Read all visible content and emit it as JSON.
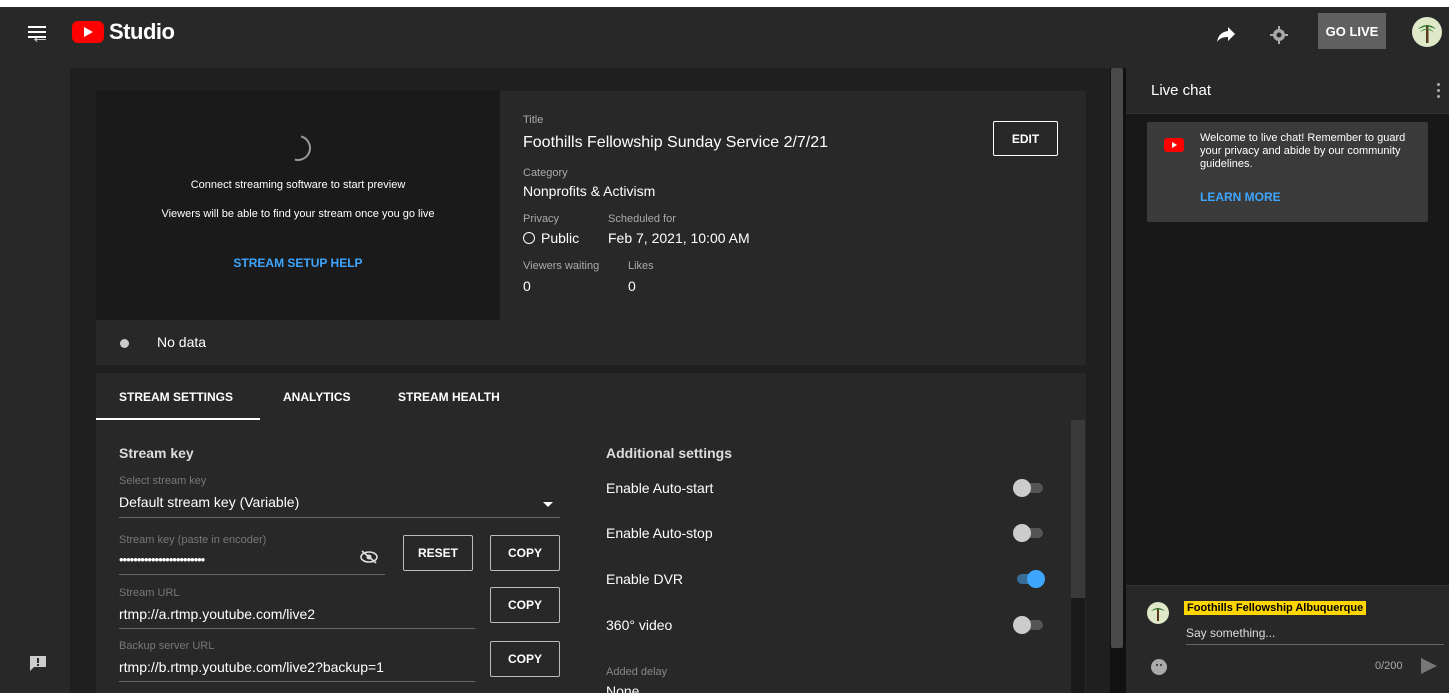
{
  "header": {
    "app_name": "Studio",
    "go_live_label": "GO LIVE",
    "icons": [
      "menu-icon",
      "share-arrow-icon",
      "gear-icon",
      "avatar"
    ]
  },
  "preview": {
    "message_line1": "Connect streaming software to start preview",
    "message_line2": "Viewers will be able to find your stream once you go live",
    "setup_help_link": "STREAM SETUP HELP"
  },
  "details": {
    "title_label": "Title",
    "title_value": "Foothills Fellowship Sunday Service 2/7/21",
    "edit_label": "EDIT",
    "category_label": "Category",
    "category_value": "Nonprofits & Activism",
    "privacy_label": "Privacy",
    "privacy_value": "Public",
    "scheduled_label": "Scheduled for",
    "scheduled_value": "Feb 7, 2021, 10:00 AM",
    "viewers_label": "Viewers waiting",
    "viewers_value": "0",
    "likes_label": "Likes",
    "likes_value": "0"
  },
  "status": {
    "text": "No data"
  },
  "tabs": [
    {
      "label": "STREAM SETTINGS",
      "active": true
    },
    {
      "label": "ANALYTICS",
      "active": false
    },
    {
      "label": "STREAM HEALTH",
      "active": false
    }
  ],
  "stream_key": {
    "section_title": "Stream key",
    "select_label": "Select stream key",
    "select_value": "Default stream key (Variable)",
    "key_label": "Stream key (paste in encoder)",
    "key_value": "••••••••••••••••••••••••",
    "reset_label": "RESET",
    "copy_label": "COPY",
    "url_label": "Stream URL",
    "url_value": "rtmp://a.rtmp.youtube.com/live2",
    "backup_label": "Backup server URL",
    "backup_value": "rtmp://b.rtmp.youtube.com/live2?backup=1"
  },
  "additional": {
    "section_title": "Additional settings",
    "toggles": [
      {
        "label": "Enable Auto-start",
        "on": false
      },
      {
        "label": "Enable Auto-stop",
        "on": false
      },
      {
        "label": "Enable DVR",
        "on": true
      },
      {
        "label": "360° video",
        "on": false
      }
    ],
    "delay_label": "Added delay",
    "delay_value": "None"
  },
  "chat": {
    "title": "Live chat",
    "welcome_text": "Welcome to live chat! Remember to guard your privacy and abide by our community guidelines.",
    "learn_more": "LEARN MORE",
    "author": "Foothills Fellowship Albuquerque",
    "placeholder": "Say something...",
    "char_count": "0/200"
  },
  "colors": {
    "accent_blue": "#3ea6ff",
    "brand_red": "#ff0000",
    "author_highlight": "#ffd600"
  }
}
